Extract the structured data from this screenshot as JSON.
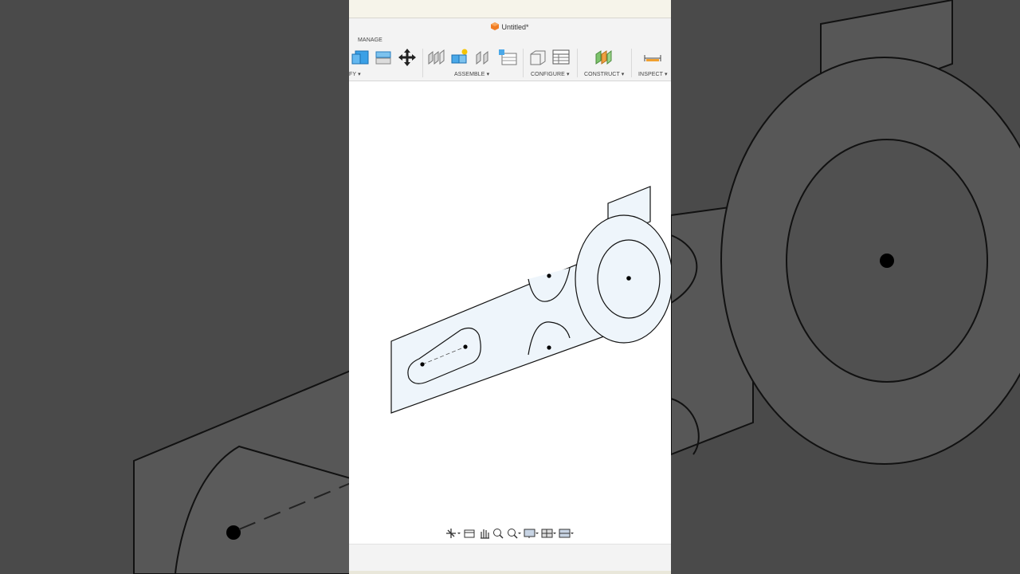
{
  "document": {
    "title": "Untitled*"
  },
  "toolbar": {
    "tab_label": "MANAGE",
    "groups": [
      {
        "id": "modify",
        "label": "FY ▾"
      },
      {
        "id": "assemble",
        "label": "ASSEMBLE ▾"
      },
      {
        "id": "configure",
        "label": "CONFIGURE ▾"
      },
      {
        "id": "construct",
        "label": "CONSTRUCT ▾"
      },
      {
        "id": "inspect",
        "label": "INSPECT ▾"
      }
    ]
  },
  "icons": {
    "toolbar": [
      "combine-icon",
      "shell-icon",
      "move-icon",
      "joint-icon",
      "new-component-icon",
      "as-built-joint-icon",
      "joint-origin-icon",
      "configure-icon",
      "configure-table-icon",
      "construct-plane-icon",
      "measure-icon"
    ],
    "navigation": [
      "orbit-icon",
      "look-at-icon",
      "pan-icon",
      "zoom-window-icon",
      "zoom-icon",
      "display-settings-icon",
      "grid-icon",
      "viewports-icon"
    ]
  },
  "colors": {
    "background": "#4a4a4a",
    "sketch_fill": "#eef5fb",
    "accent": "#f07c22"
  }
}
